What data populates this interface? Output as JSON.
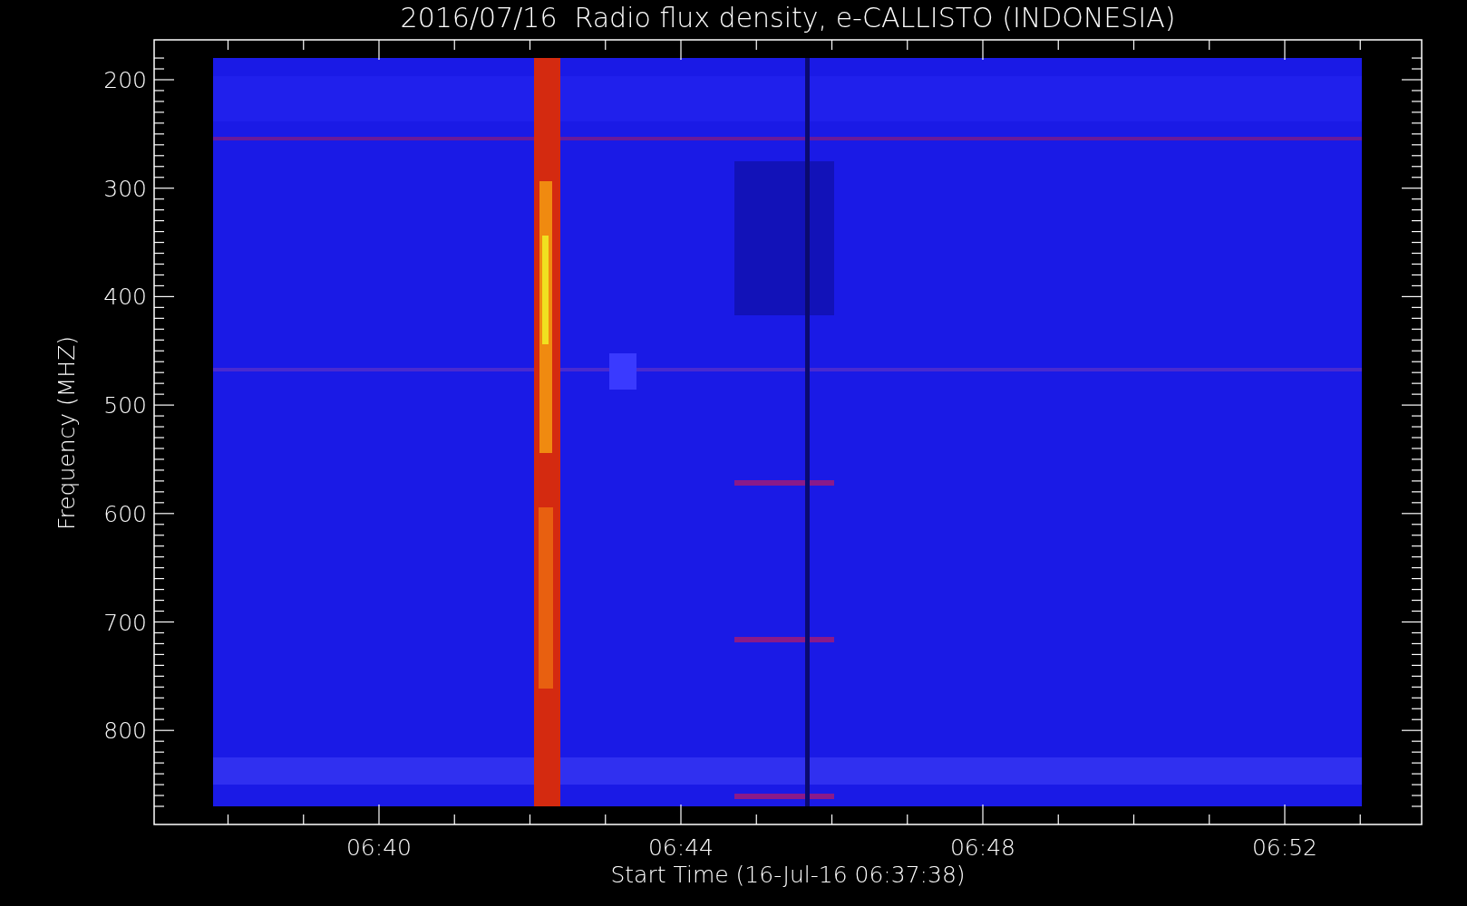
{
  "title": "2016/07/16  Radio flux density, e-CALLISTO (INDONESIA)",
  "y_axis": {
    "label": "Frequency (MHZ)",
    "ticks": [
      "200",
      "300",
      "400",
      "500",
      "600",
      "700",
      "800"
    ]
  },
  "x_axis": {
    "label": "Start Time (16-Jul-16 06:37:38)",
    "ticks": [
      "06:40",
      "06:44",
      "06:48",
      "06:52"
    ]
  }
}
